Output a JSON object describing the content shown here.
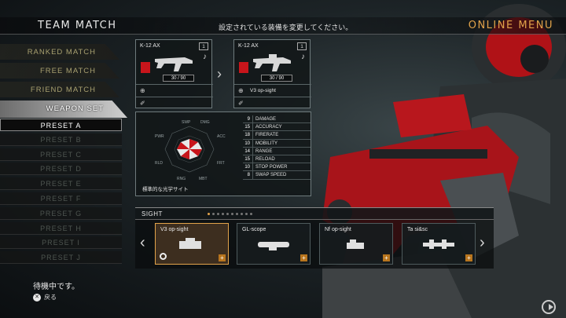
{
  "header": {
    "mode_title": "TEAM MATCH",
    "instruction": "設定されている装備を変更してください。",
    "online_menu": "ONLINE MENU"
  },
  "menu": {
    "items": [
      {
        "label": "RANKED MATCH"
      },
      {
        "label": "FREE MATCH"
      },
      {
        "label": "FRIEND MATCH"
      },
      {
        "label": "WEAPON SET"
      }
    ],
    "active": "WEAPON SET"
  },
  "presets": {
    "items": [
      {
        "label": "PRESET A"
      },
      {
        "label": "PRESET B"
      },
      {
        "label": "PRESET C"
      },
      {
        "label": "PRESET D"
      },
      {
        "label": "PRESET E"
      },
      {
        "label": "PRESET F"
      },
      {
        "label": "PRESET G"
      },
      {
        "label": "PRESET H"
      },
      {
        "label": "PRESET I"
      },
      {
        "label": "PRESET J"
      }
    ],
    "active": "PRESET A"
  },
  "current_weapon": {
    "name": "K-12 AX",
    "slot": "1",
    "ammo": "30 / 90",
    "sight": "",
    "accent": "#c8151b"
  },
  "new_weapon": {
    "name": "K-12 AX",
    "slot": "1",
    "ammo": "30 / 90",
    "sight": "V3 op-sight",
    "accent": "#c8151b"
  },
  "stats": {
    "radar_labels": [
      "SWP",
      "DMG",
      "ACC",
      "FRT",
      "MBT",
      "RNG",
      "RLD",
      "PWR"
    ],
    "caption": "標準的な光学サイト",
    "rows": [
      {
        "value": "9",
        "label": "DAMAGE"
      },
      {
        "value": "15",
        "label": "ACCURACY"
      },
      {
        "value": "18",
        "label": "FIRERATE"
      },
      {
        "value": "10",
        "label": "MOBILITY"
      },
      {
        "value": "14",
        "label": "RANGE"
      },
      {
        "value": "15",
        "label": "RELOAD"
      },
      {
        "value": "10",
        "label": "STOP POWER"
      },
      {
        "value": "8",
        "label": "SWAP SPEED"
      }
    ]
  },
  "sight_selector": {
    "label": "SIGHT",
    "page_index": 0,
    "page_count": 10,
    "accent": "#e2a34a",
    "options": [
      {
        "name": "V3 op-sight",
        "selected": true
      },
      {
        "name": "GL-scope",
        "selected": false
      },
      {
        "name": "Nf op-sight",
        "selected": false
      },
      {
        "name": "Ta si&sc",
        "selected": false
      }
    ]
  },
  "footer": {
    "status": "待機中です。",
    "back_label": "戻る",
    "back_button_icon": "circle-button-icon"
  }
}
